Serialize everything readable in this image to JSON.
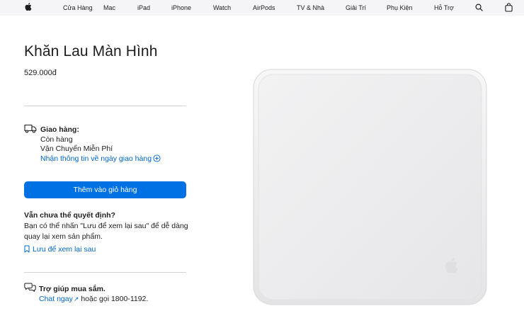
{
  "nav": {
    "items": [
      "Cửa Hàng",
      "Mac",
      "iPad",
      "iPhone",
      "Watch",
      "AirPods",
      "TV & Nhà",
      "Giải Trí",
      "Phụ Kiện",
      "Hỗ Trợ"
    ],
    "logo_icon": "apple-logo-icon",
    "search_icon": "search-icon",
    "bag_icon": "shopping-bag-icon"
  },
  "product": {
    "title": "Khăn Lau Màn Hình",
    "price": "529.000đ",
    "image_icon": "polishing-cloth-image"
  },
  "delivery": {
    "icon": "truck-icon",
    "title": "Giao hàng:",
    "stock": "Còn hàng",
    "shipping": "Vận Chuyển Miễn Phí",
    "link": "Nhận thông tin về ngày giao hàng"
  },
  "cart": {
    "add_label": "Thêm vào giỏ hàng"
  },
  "undecided": {
    "title": "Vẫn chưa thể quyết định?",
    "body": "Bạn có thể nhấn \"Lưu để xem lại sau\" để dễ dàng quay lại xem sản phẩm.",
    "save_link": "Lưu để xem lại sau"
  },
  "help": {
    "icon": "chat-bubbles-icon",
    "title": "Trợ giúp mua sắm.",
    "chat_link": "Chat ngay",
    "call_text": "hoặc gọi 1800-1192."
  },
  "colors": {
    "nav_bg": "#f5f5f7",
    "text": "#1d1d1f",
    "link": "#0066cc",
    "button": "#0071e3",
    "divider": "#d2d2d7"
  }
}
